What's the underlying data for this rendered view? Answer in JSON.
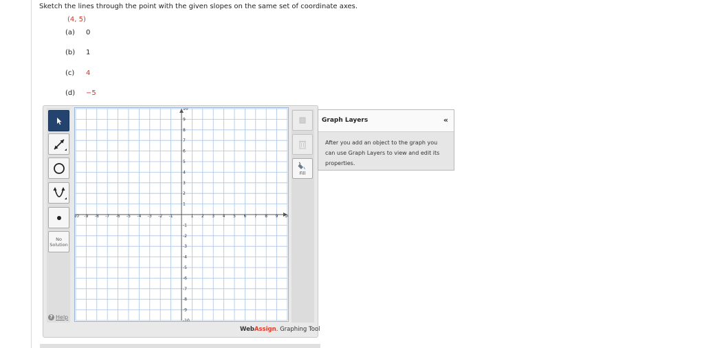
{
  "question": {
    "prompt": "Sketch the lines through the point with the given slopes on the same set of coordinate axes.",
    "point": "(4, 5)",
    "parts": [
      {
        "letter": "(a)",
        "value": "0"
      },
      {
        "letter": "(b)",
        "value": "1"
      },
      {
        "letter": "(c)",
        "value": "4"
      },
      {
        "letter": "(d)",
        "value": "−5"
      }
    ]
  },
  "tools": {
    "no_solution": "No Solution",
    "help": "Help"
  },
  "right_tools": {
    "fill": "Fill"
  },
  "graph": {
    "xmin": -10,
    "xmax": 10,
    "ymin": -10,
    "ymax": 10,
    "x_ticks": [
      "-10",
      "-9",
      "-8",
      "-7",
      "-6",
      "-5",
      "-4",
      "-3",
      "-2",
      "-1",
      "1",
      "2",
      "3",
      "4",
      "5",
      "6",
      "7",
      "8",
      "9",
      "10"
    ],
    "y_ticks": [
      "10",
      "9",
      "8",
      "7",
      "6",
      "5",
      "4",
      "3",
      "2",
      "1",
      "-1",
      "-2",
      "-3",
      "-4",
      "-5",
      "-6",
      "-7",
      "-8",
      "-9",
      "-10"
    ]
  },
  "brand": {
    "web": "Web",
    "assign": "Assign",
    "rest": ". Graphing Tool"
  },
  "layers": {
    "title": "Graph Layers",
    "collapse": "«",
    "body": "After you add an object to the graph you can use Graph Layers to view and edit its properties."
  },
  "colors": {
    "accent_red": "#c0392b",
    "active_tool": "#24446f",
    "grid": "#a9c3e3"
  }
}
